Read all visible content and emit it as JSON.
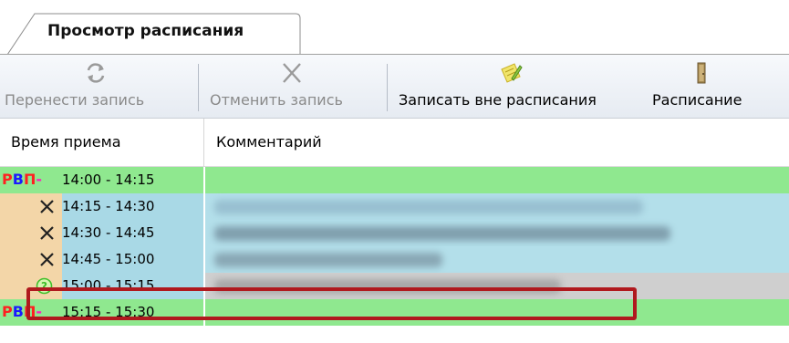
{
  "tab": {
    "title": "Просмотр расписания"
  },
  "toolbar": {
    "transfer": {
      "label": "Перенести запись",
      "icon": "transfer-arrows-icon"
    },
    "cancel": {
      "label": "Отменить запись",
      "icon": "cancel-x-icon"
    },
    "book_outside": {
      "label": "Записать вне расписания",
      "icon": "pencil-note-icon"
    },
    "schedule": {
      "label": "Расписание",
      "icon": "door-icon"
    },
    "overflow_icon": "chevron-down-icon"
  },
  "grid": {
    "columns": {
      "time": "Время приема",
      "comment": "Комментарий"
    },
    "marker_rvp": {
      "r": "Р",
      "v": "В",
      "p": "П",
      "dash": "-"
    },
    "rows": [
      {
        "time": "14:00 - 14:15",
        "status": "free"
      },
      {
        "time": "14:15 - 14:30",
        "status": "cancelled"
      },
      {
        "time": "14:30 - 14:45",
        "status": "cancelled"
      },
      {
        "time": "14:45 - 15:00",
        "status": "cancelled"
      },
      {
        "time": "15:00 - 15:15",
        "status": "pending",
        "selected": true
      },
      {
        "time": "15:15 - 15:30",
        "status": "free"
      }
    ]
  },
  "colors": {
    "free": "#8fe88f",
    "busy_time": "#a9d9e6",
    "busy_comment": "#b3dfea",
    "marker_bg": "#f3d6a8",
    "selected_comment": "#cfcfcf",
    "highlight": "#b0191e"
  }
}
